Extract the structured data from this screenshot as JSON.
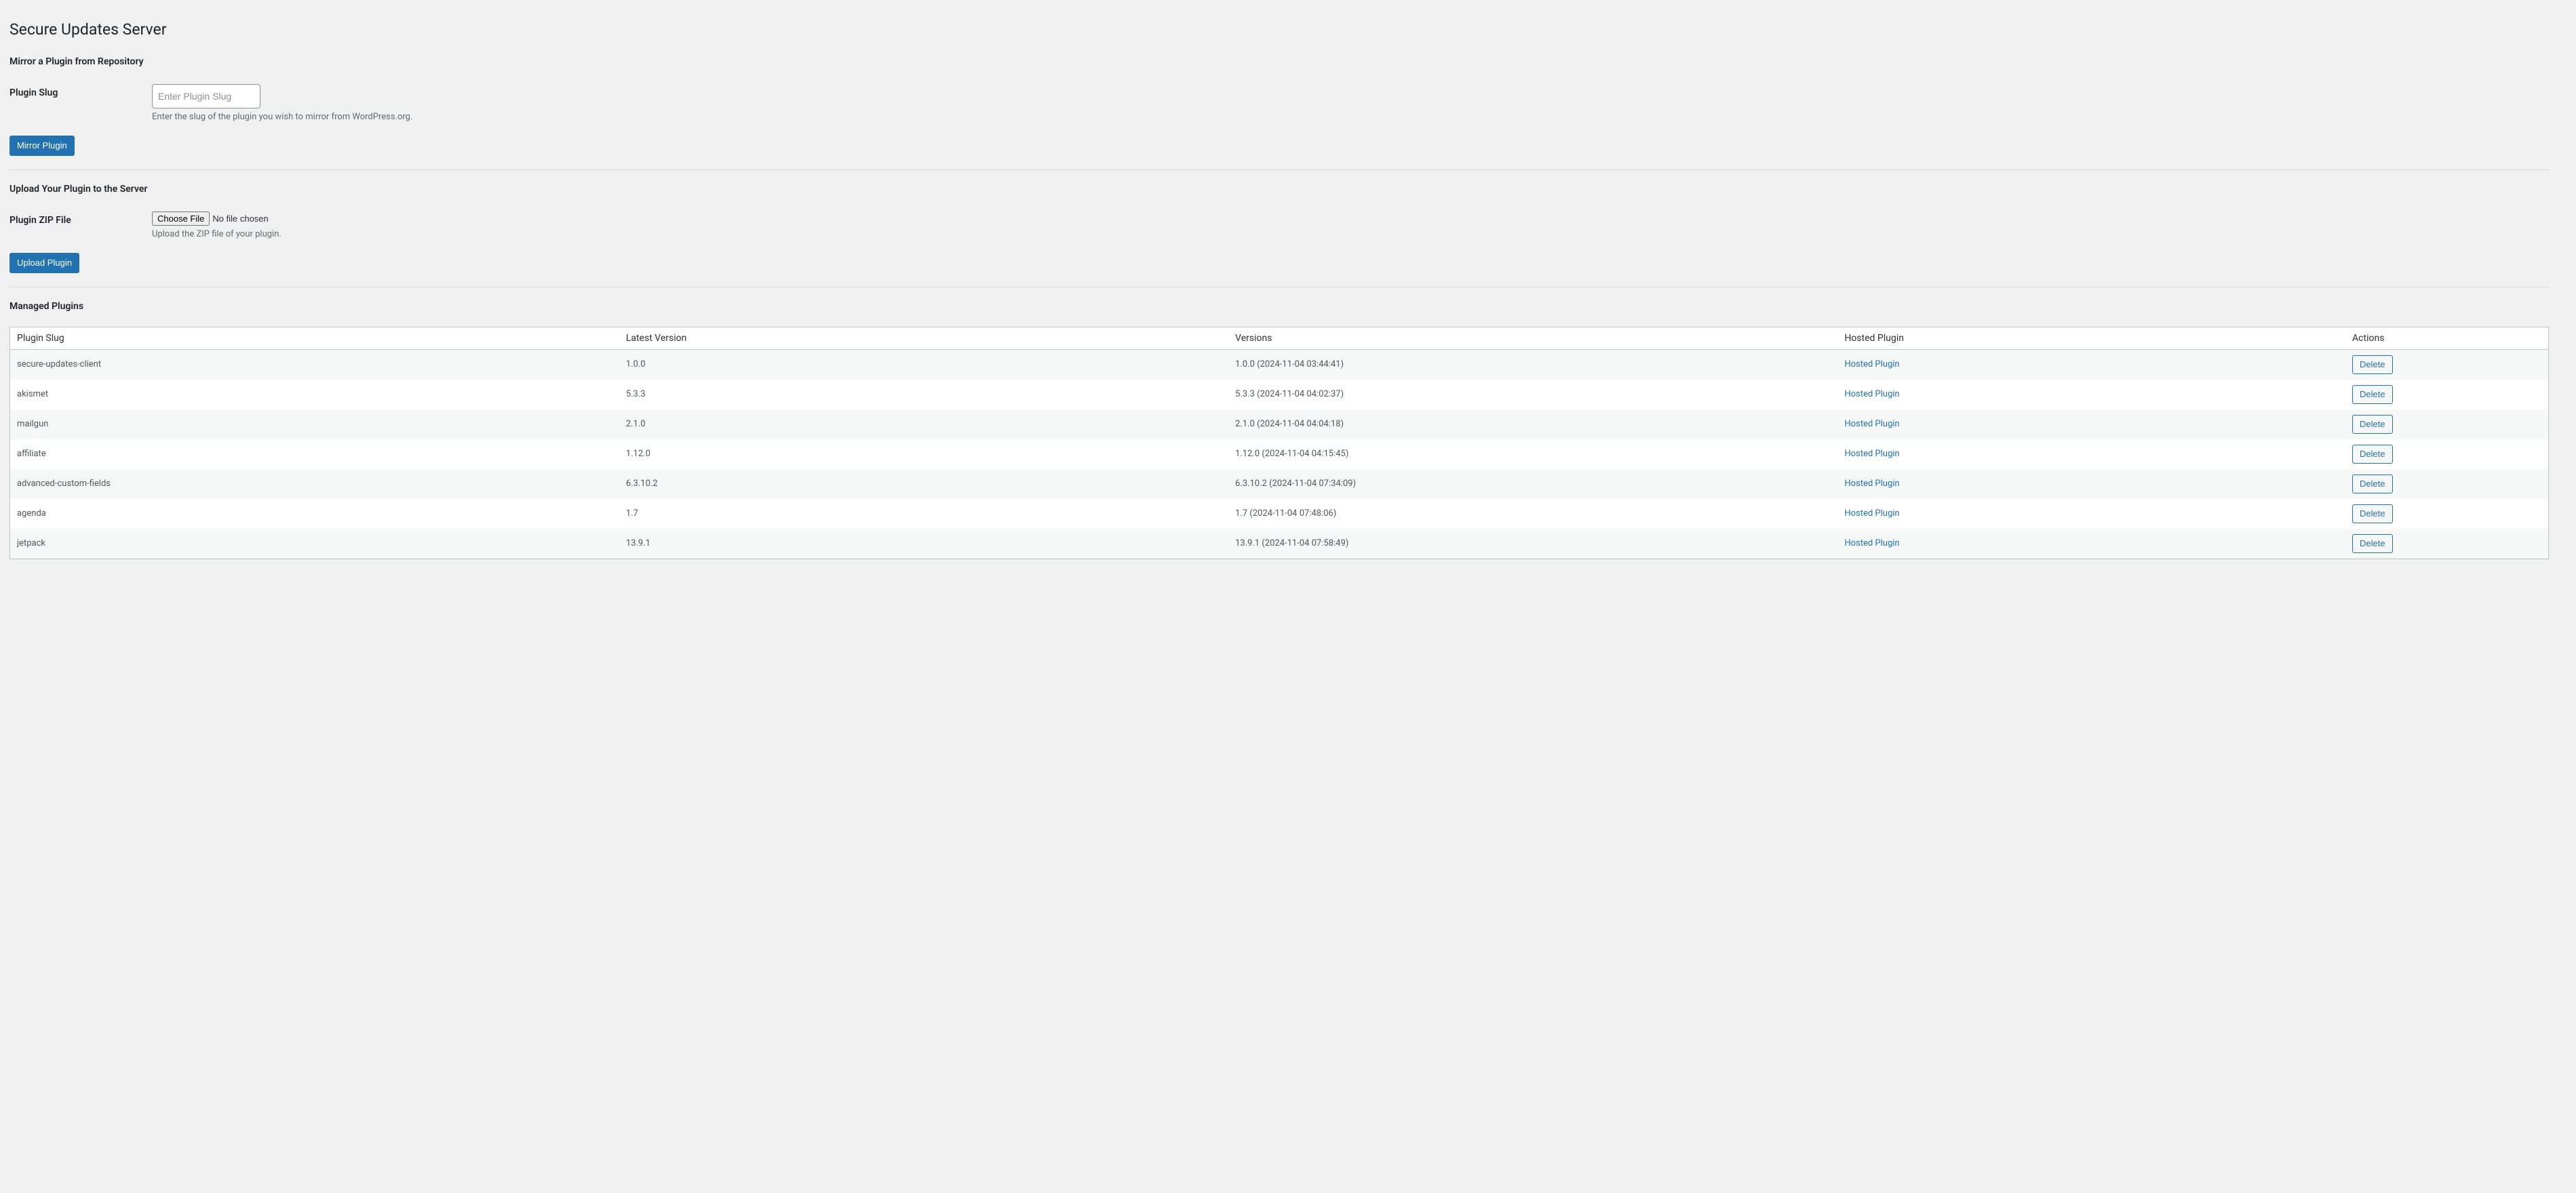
{
  "page_title": "Secure Updates Server",
  "mirror_section": {
    "heading": "Mirror a Plugin from Repository",
    "slug_label": "Plugin Slug",
    "slug_placeholder": "Enter Plugin Slug",
    "slug_description": "Enter the slug of the plugin you wish to mirror from WordPress.org.",
    "button": "Mirror Plugin"
  },
  "upload_section": {
    "heading": "Upload Your Plugin to the Server",
    "file_label": "Plugin ZIP File",
    "choose_file_label": "Choose File",
    "no_file_text": "No file chosen",
    "file_description": "Upload the ZIP file of your plugin.",
    "button": "Upload Plugin"
  },
  "managed": {
    "heading": "Managed Plugins",
    "columns": {
      "slug": "Plugin Slug",
      "latest": "Latest Version",
      "versions": "Versions",
      "hosted": "Hosted Plugin",
      "actions": "Actions"
    },
    "hosted_link_text": "Hosted Plugin",
    "delete_button": "Delete",
    "rows": [
      {
        "slug": "secure-updates-client",
        "latest": "1.0.0",
        "versions": "1.0.0 (2024-11-04 03:44:41)"
      },
      {
        "slug": "akismet",
        "latest": "5.3.3",
        "versions": "5.3.3 (2024-11-04 04:02:37)"
      },
      {
        "slug": "mailgun",
        "latest": "2.1.0",
        "versions": "2.1.0 (2024-11-04 04:04:18)"
      },
      {
        "slug": "affiliate",
        "latest": "1.12.0",
        "versions": "1.12.0 (2024-11-04 04:15:45)"
      },
      {
        "slug": "advanced-custom-fields",
        "latest": "6.3.10.2",
        "versions": "6.3.10.2 (2024-11-04 07:34:09)"
      },
      {
        "slug": "agenda",
        "latest": "1.7",
        "versions": "1.7 (2024-11-04 07:48:06)"
      },
      {
        "slug": "jetpack",
        "latest": "13.9.1",
        "versions": "13.9.1 (2024-11-04 07:58:49)"
      }
    ]
  }
}
